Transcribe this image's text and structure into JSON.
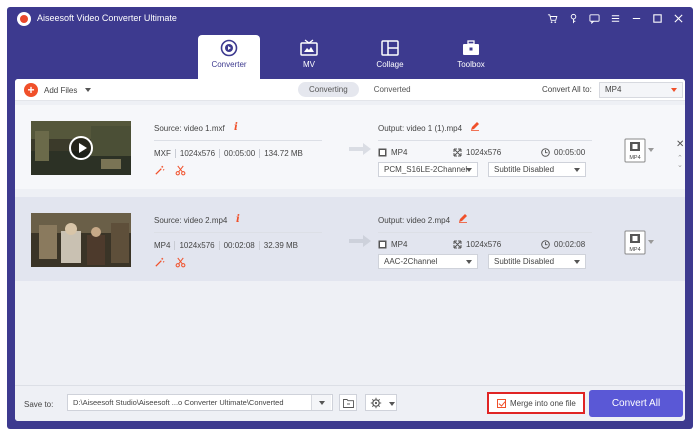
{
  "window": {
    "title": "Aiseesoft Video Converter Ultimate",
    "icons": [
      "cart-icon",
      "key-icon",
      "chat-icon",
      "menu-icon",
      "minimize-icon",
      "maximize-icon",
      "close-icon"
    ]
  },
  "tabs": [
    {
      "label": "Converter",
      "icon": "converter-icon",
      "active": true
    },
    {
      "label": "MV",
      "icon": "tv-icon",
      "active": false
    },
    {
      "label": "Collage",
      "icon": "collage-icon",
      "active": false
    },
    {
      "label": "Toolbox",
      "icon": "toolbox-icon",
      "active": false
    }
  ],
  "toolbar": {
    "add_files": "Add Files",
    "seg_converting": "Converting",
    "seg_converted": "Converted",
    "convert_all_to": "Convert All to:",
    "format": "MP4"
  },
  "files": [
    {
      "source": "Source: video 1.mxf",
      "src_format": "MXF",
      "src_resolution": "1024x576",
      "src_duration": "00:05:00",
      "src_size": "134.72 MB",
      "output": "Output: video 1 (1).mp4",
      "out_format": "MP4",
      "out_resolution": "1024x576",
      "out_duration": "00:05:00",
      "audio": "PCM_S16LE-2Channel",
      "subtitle": "Subtitle Disabled",
      "badge": "MP4"
    },
    {
      "source": "Source: video 2.mp4",
      "src_format": "MP4",
      "src_resolution": "1024x576",
      "src_duration": "00:02:08",
      "src_size": "32.39 MB",
      "output": "Output: video 2.mp4",
      "out_format": "MP4",
      "out_resolution": "1024x576",
      "out_duration": "00:02:08",
      "audio": "AAC-2Channel",
      "subtitle": "Subtitle Disabled",
      "badge": "MP4"
    }
  ],
  "bottom": {
    "save_to": "Save to:",
    "path": "D:\\Aiseesoft Studio\\Aiseesoft ...o Converter Ultimate\\Converted",
    "merge_label": "Merge into one file",
    "merge_checked": true,
    "convert_all": "Convert All"
  },
  "colors": {
    "window_bg": "#3d3a8f",
    "accent": "#f0502a",
    "primary_button": "#5a58d6",
    "highlight_border": "#e02424"
  }
}
